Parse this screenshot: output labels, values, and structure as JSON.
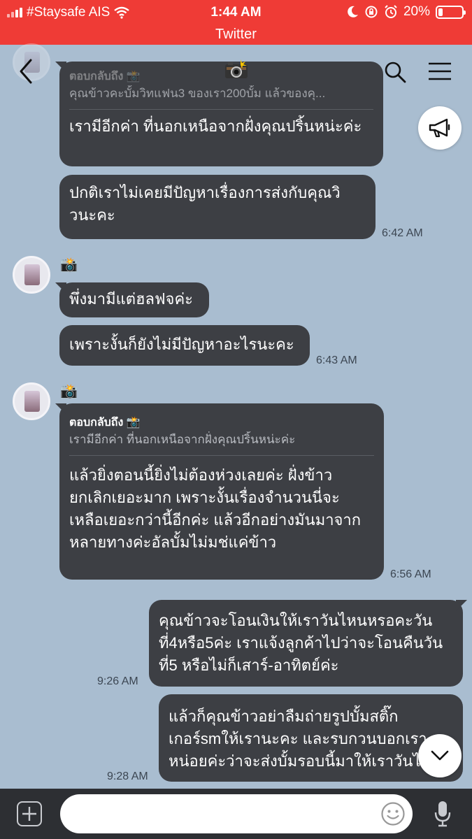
{
  "status_bar": {
    "carrier": "#Staysafe AIS",
    "time": "1:44 AM",
    "battery": "20%",
    "battery_level": 0.2
  },
  "app_bar": {
    "title": "Twitter"
  },
  "chat_header": {
    "title_icon": "camera-flash-emoji",
    "back_icon": "chevron-left-icon",
    "search_icon": "search-icon",
    "menu_icon": "hamburger-menu-icon"
  },
  "messages": [
    {
      "reply_label": "ตอบกลับถึง 📸",
      "reply_quote": "คุณข้าวคะบั้มวิทแฟน3 ของเรา200บั้ม แล้วของคุ...",
      "text": "เรามีอีกค่า ที่นอกเหนือจากฝั่งคุณปริ้นหน่ะค่ะ"
    },
    {
      "text_lines": [
        "ปกติเราไม่เคยมีปัญหาเรื่องการส่งกับคุณวิ",
        "วนะคะ"
      ],
      "time": "6:42 AM"
    },
    {
      "sender": "📸",
      "text": "พึ่งมามีแต่ฮลฟจค่ะ"
    },
    {
      "text": "เพราะงั้นก็ยังไม่มีปัญหาอะไรนะคะ",
      "time": "6:43 AM"
    },
    {
      "sender": "📸",
      "reply_label": "ตอบกลับถึง 📸",
      "reply_quote": "เรามีอีกค่า ที่นอกเหนือจากฝั่งคุณปริ้นหน่ะค่ะ",
      "text_lines": [
        "แล้วยิ่งตอนนี้ยิ่งไม่ต้องห่วงเลยค่ะ ฝั่งข้าว",
        "ยกเลิกเยอะมาก เพราะงั้นเรื่องจำนวนนี่จะ",
        "เหลือเยอะกว่านี้อีกค่ะ แล้วอีกอย่างมันมาจาก",
        "หลายทางค่ะอัลบั้มไม่มช่แค่ข้าว"
      ],
      "time": "6:56 AM"
    },
    {
      "text_lines": [
        "คุณข้าวจะโอนเงินให้เราวันไหนหรอคะวัน",
        "ที่4หรือ5ค่ะ เราแจ้งลูกค้าไปว่าจะโอนคืนวัน",
        "ที่5 หรือไม่ก็เสาร์-อาทิตย์ค่ะ"
      ],
      "time": "9:26 AM"
    },
    {
      "text_lines": [
        "แล้วก็คุณข้าวอย่าลืมถ่ายรูปบั้มสติ๊ก",
        "เกอร์smให้เรานะคะ และรบกวนบอกเรา",
        "หน่อยค่ะว่าจะส่งบั้มรอบนี้มาให้เราวันไหน"
      ],
      "time": "9:28 AM"
    }
  ],
  "input": {
    "placeholder": ""
  },
  "icons": {
    "announce": "megaphone-icon",
    "scroll_down": "chevron-down-icon",
    "plus": "plus-icon",
    "emoji": "smiley-icon",
    "mic": "microphone-icon"
  }
}
